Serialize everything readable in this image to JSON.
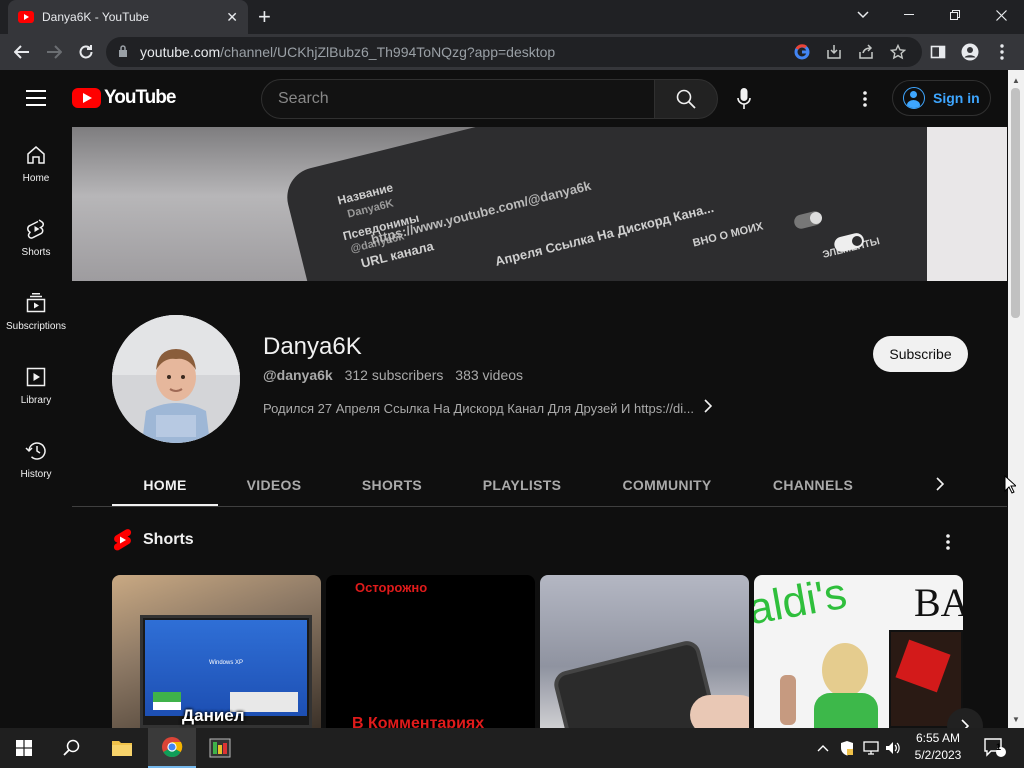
{
  "browser": {
    "tab_title": "Danya6K - YouTube",
    "tab_close": "✕",
    "new_tab": "+",
    "url_host": "youtube.com",
    "url_path": "/channel/UCKhjZlBubz6_Th994ToNQzg?app=desktop"
  },
  "header": {
    "logo_text": "YouTube",
    "search_placeholder": "Search",
    "sign_in": "Sign in"
  },
  "guide": {
    "items": [
      {
        "label": "Home",
        "icon": "home-icon"
      },
      {
        "label": "Shorts",
        "icon": "shorts-icon"
      },
      {
        "label": "Subscriptions",
        "icon": "subscriptions-icon"
      },
      {
        "label": "Library",
        "icon": "library-icon"
      },
      {
        "label": "History",
        "icon": "history-icon"
      }
    ]
  },
  "banner": {
    "lines": [
      "Название",
      "Danya6K",
      "Псевдонимы",
      "@danya6k",
      "URL канала",
      "https://www.youtube.com/@danya6k",
      "Апреля Ссылка На Дискорд Кана...",
      "ВНО О МОИХ",
      "ЭЛЕМЕНТЫ"
    ]
  },
  "channel": {
    "name": "Danya6K",
    "handle": "@danya6k",
    "subscribers": "312 subscribers",
    "videos": "383 videos",
    "description": "Родился 27 Апреля Ссылка На Дискорд Канал Для Друзей И https://di...",
    "subscribe_label": "Subscribe"
  },
  "tabs": [
    "HOME",
    "VIDEOS",
    "SHORTS",
    "PLAYLISTS",
    "COMMUNITY",
    "CHANNELS"
  ],
  "shorts": {
    "title": "Shorts",
    "items": [
      {
        "caption": "Даниел",
        "screen_text": "Windows XP"
      },
      {
        "caption": "Осторожно",
        "caption2": "В Комментариях"
      },
      {
        "caption": ""
      },
      {
        "caption": "aldi's",
        "caption2": "BA"
      }
    ]
  },
  "taskbar": {
    "time": "6:55 AM",
    "date": "5/2/2023",
    "notifications": "1"
  },
  "colors": {
    "yt_red": "#ff0000",
    "link_blue": "#3ea6ff",
    "background": "#0f0f0f"
  }
}
